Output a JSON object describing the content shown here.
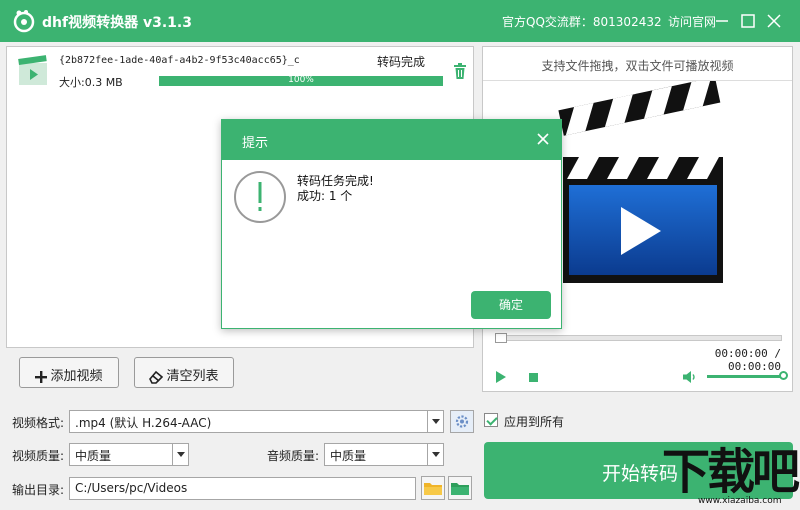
{
  "titlebar": {
    "app_title": "dhf视频转换器 v3.1.3",
    "qq_group": "官方QQ交流群：801302432",
    "visit_site": "访问官网"
  },
  "file_list": {
    "items": [
      {
        "name": "{2b872fee-1ade-40af-a4b2-9f53c40acc65}_c",
        "status": "转码完成",
        "size": "大小:0.3 MB",
        "progress_label": "100%",
        "progress": 1.0
      }
    ]
  },
  "buttons": {
    "add_video": "添加视频",
    "clear_list": "清空列表"
  },
  "preview": {
    "hint": "支持文件拖拽，双击文件可播放视频",
    "time": "00:00:00 / 00:00:00"
  },
  "settings": {
    "format_label": "视频格式:",
    "format_value": ".mp4 (默认 H.264-AAC)",
    "apply_all": "应用到所有",
    "video_quality_label": "视频质量:",
    "video_quality_value": "中质量",
    "audio_quality_label": "音频质量:",
    "audio_quality_value": "中质量",
    "output_label": "输出目录:",
    "output_value": "C:/Users/pc/Videos"
  },
  "start_button": "开始转码",
  "watermark": {
    "main": "下载吧",
    "sub": "www.xiazaiba.com"
  },
  "dialog": {
    "title": "提示",
    "message_line1": "转码任务完成!",
    "message_line2": "成功:  1 个",
    "ok_label": "确定"
  },
  "colors": {
    "accent": "#3cb371"
  }
}
